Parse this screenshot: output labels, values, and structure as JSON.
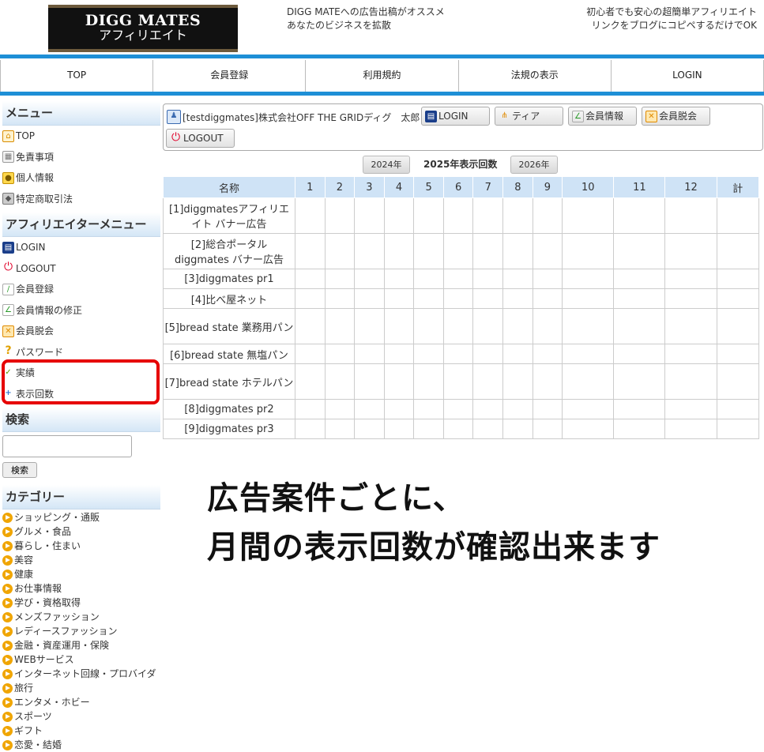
{
  "header": {
    "logo_line1": "DIGG MATES",
    "logo_line2": "アフィリエイト",
    "left_text": [
      "DIGG MATEへの広告出稿がオススメ",
      "あなたのビジネスを拡散"
    ],
    "right_text": [
      "初心者でも安心の超簡単アフィリエイト",
      "リンクをブログにコピペするだけでOK"
    ]
  },
  "nav": [
    "TOP",
    "会員登録",
    "利用規約",
    "法規の表示",
    "LOGIN"
  ],
  "sidebar": {
    "menu_title": "メニュー",
    "menu_items": [
      {
        "label": "TOP",
        "icon": "home-icon"
      },
      {
        "label": "免責事項",
        "icon": "document-icon"
      },
      {
        "label": "個人情報",
        "icon": "lock-icon"
      },
      {
        "label": "特定商取引法",
        "icon": "box-icon"
      }
    ],
    "affiliate_title": "アフィリエイターメニュー",
    "affiliate_items": [
      {
        "label": "LOGIN",
        "icon": "login-icon"
      },
      {
        "label": "LOGOUT",
        "icon": "power-icon"
      },
      {
        "label": "会員登録",
        "icon": "pencil-icon"
      },
      {
        "label": "会員情報の修正",
        "icon": "edit-icon"
      },
      {
        "label": "会員脱会",
        "icon": "cross-icon"
      },
      {
        "label": "パスワード",
        "icon": "question-icon"
      },
      {
        "label": "実績",
        "icon": "check-icon"
      },
      {
        "label": "表示回数",
        "icon": "plus-icon"
      }
    ],
    "search_title": "検索",
    "search_button": "検索",
    "category_title": "カテゴリー",
    "categories": [
      "ショッピング・通販",
      "グルメ・食品",
      "暮らし・住まい",
      "美容",
      "健康",
      "お仕事情報",
      "学び・資格取得",
      "メンズファッション",
      "レディースファッション",
      "金融・資産運用・保険",
      "WEBサービス",
      "インターネット回線・プロバイダ",
      "旅行",
      "エンタメ・ホビー",
      "スポーツ",
      "ギフト",
      "恋愛・結婚"
    ]
  },
  "user": {
    "name": "[testdiggmates]株式会社OFF THE GRIDディグ　太郎",
    "buttons": [
      "LOGIN",
      "ティア",
      "会員情報",
      "会員脱会",
      "LOGOUT"
    ]
  },
  "years": {
    "prev": "2024年",
    "current": "2025年表示回数",
    "next": "2026年"
  },
  "table": {
    "header": [
      "名称",
      "1",
      "2",
      "3",
      "4",
      "5",
      "6",
      "7",
      "8",
      "9",
      "10",
      "11",
      "12",
      "計"
    ],
    "rows": [
      "[1]diggmatesアフィリエイト バナー広告",
      "[2]総合ポータル diggmates バナー広告",
      "[3]diggmates pr1",
      "[4]比べ屋ネット",
      "[5]bread state 業務用パン",
      "[6]bread state 無塩パン",
      "[7]bread state ホテルパン",
      "[8]diggmates pr2",
      "[9]diggmates pr3"
    ]
  },
  "caption": [
    "広告案件ごとに、",
    "月間の表示回数が確認出来ます"
  ]
}
